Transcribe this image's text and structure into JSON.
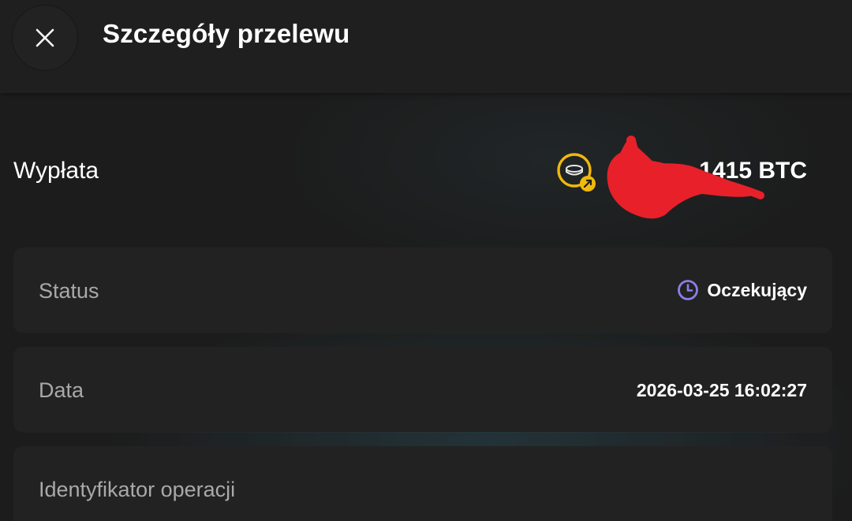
{
  "header": {
    "title": "Szczegóły przelewu",
    "close_icon": "close-icon"
  },
  "transfer": {
    "type_label": "Wypłata",
    "amount_visible": "1415 BTC",
    "coin_icon": "coin-withdraw-icon"
  },
  "details": {
    "status": {
      "label": "Status",
      "value": "Oczekujący",
      "icon": "clock-icon",
      "icon_color": "#8b7fe8"
    },
    "date": {
      "label": "Data",
      "value": "2026-03-25 16:02:27"
    },
    "operation_id": {
      "label": "Identyfikator operacji"
    }
  },
  "colors": {
    "accent_coin": "#f0b90b",
    "redaction": "#e8202a"
  }
}
